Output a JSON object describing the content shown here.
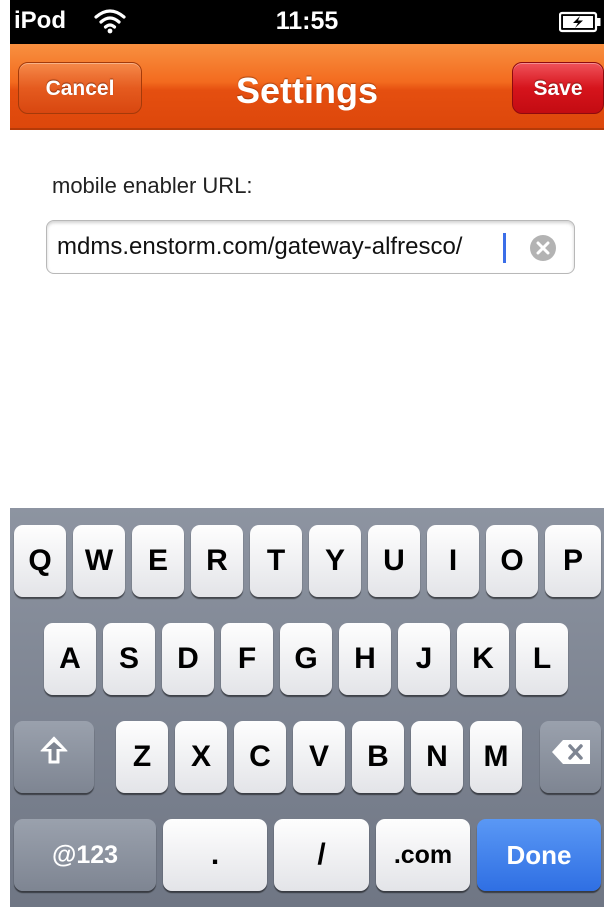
{
  "status_bar": {
    "device": "iPod",
    "time": "11:55",
    "wifi_icon": "wifi-icon",
    "battery_icon": "battery-charging-icon"
  },
  "nav": {
    "title": "Settings",
    "cancel_label": "Cancel",
    "save_label": "Save"
  },
  "form": {
    "label": "mobile enabler URL:",
    "url_value": "mdms.enstorm.com/gateway-alfresco/",
    "clear_icon": "clear-icon"
  },
  "keyboard": {
    "row1": [
      "Q",
      "W",
      "E",
      "R",
      "T",
      "Y",
      "U",
      "I",
      "O",
      "P"
    ],
    "row2": [
      "A",
      "S",
      "D",
      "F",
      "G",
      "H",
      "J",
      "K",
      "L"
    ],
    "row3": [
      "Z",
      "X",
      "C",
      "V",
      "B",
      "N",
      "M"
    ],
    "shift_icon": "shift-icon",
    "backspace_icon": "backspace-icon",
    "numbers_label": "@123",
    "dot_label": ".",
    "slash_label": "/",
    "dotcom_label": ".com",
    "done_label": "Done"
  },
  "colors": {
    "nav_orange": "#f36b1f",
    "save_red": "#d6141c",
    "done_blue": "#2f6fe3",
    "cursor_blue": "#3b6ee8"
  }
}
